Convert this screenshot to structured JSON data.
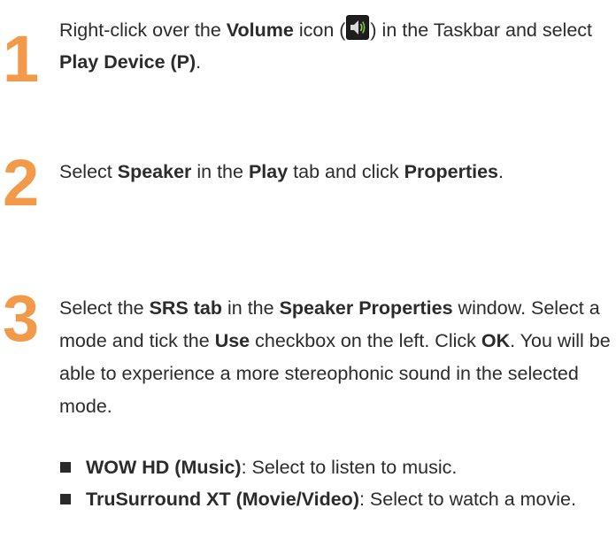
{
  "steps": [
    {
      "number": "1",
      "parts": [
        {
          "t": "Right-click over the "
        },
        {
          "b": "Volume"
        },
        {
          "t": " icon ("
        },
        {
          "icon": "volume-icon"
        },
        {
          "t": ") in the Taskbar and select "
        },
        {
          "b": "Play Device (P)"
        },
        {
          "t": "."
        }
      ]
    },
    {
      "number": "2",
      "parts": [
        {
          "t": "Select "
        },
        {
          "b": "Speaker"
        },
        {
          "t": " in the "
        },
        {
          "b": "Play"
        },
        {
          "t": " tab and click "
        },
        {
          "b": "Properties"
        },
        {
          "t": "."
        }
      ]
    },
    {
      "number": "3",
      "parts": [
        {
          "t": "Select the "
        },
        {
          "b": "SRS tab"
        },
        {
          "t": " in the "
        },
        {
          "b": "Speaker Properties"
        },
        {
          "t": " window. Select a mode and tick the "
        },
        {
          "b": "Use"
        },
        {
          "t": " checkbox on the left. Click "
        },
        {
          "b": "OK"
        },
        {
          "t": ". You will be able to experience a more stereophonic sound in the selected mode."
        }
      ]
    }
  ],
  "bullets": [
    {
      "label": "WOW HD (Music)",
      "desc": ": Select to listen to music."
    },
    {
      "label": "TruSurround XT (Movie/Video)",
      "desc": ": Select to watch a movie."
    }
  ],
  "colors": {
    "step_number": "#f29a4a",
    "text": "#2b2b2b"
  }
}
